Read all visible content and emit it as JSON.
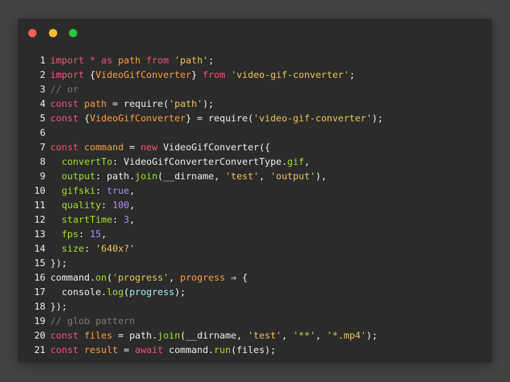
{
  "window": {
    "controls": [
      {
        "name": "close",
        "color": "#ff5f56"
      },
      {
        "name": "minimize",
        "color": "#ffbd2e"
      },
      {
        "name": "maximize",
        "color": "#27c93f"
      }
    ]
  },
  "colors": {
    "background": "#434343",
    "editor": "#2a2b2a",
    "keyword": "#f5547c",
    "variable": "#ff9f43",
    "string": "#f1c45d",
    "function": "#a6e22e",
    "number": "#b18cff",
    "comment": "#7d7d74"
  },
  "code": {
    "lines": [
      {
        "n": "1",
        "tokens": [
          [
            "import",
            "kw"
          ],
          [
            " ",
            "pl"
          ],
          [
            "*",
            "kw"
          ],
          [
            " ",
            "pl"
          ],
          [
            "as",
            "kw"
          ],
          [
            " ",
            "pl"
          ],
          [
            "path",
            "var"
          ],
          [
            " ",
            "pl"
          ],
          [
            "from",
            "kw"
          ],
          [
            " ",
            "pl"
          ],
          [
            "'path'",
            "str"
          ],
          [
            ";",
            "pl"
          ]
        ]
      },
      {
        "n": "2",
        "tokens": [
          [
            "import",
            "kw"
          ],
          [
            " {",
            "pl"
          ],
          [
            "VideoGifConverter",
            "var"
          ],
          [
            "} ",
            "pl"
          ],
          [
            "from",
            "kw"
          ],
          [
            " ",
            "pl"
          ],
          [
            "'video-gif-converter'",
            "str"
          ],
          [
            ";",
            "pl"
          ]
        ]
      },
      {
        "n": "3",
        "tokens": [
          [
            "// or",
            "cm"
          ]
        ]
      },
      {
        "n": "4",
        "tokens": [
          [
            "const",
            "kw"
          ],
          [
            " ",
            "pl"
          ],
          [
            "path",
            "var"
          ],
          [
            " = require(",
            "pl"
          ],
          [
            "'path'",
            "str"
          ],
          [
            ");",
            "pl"
          ]
        ]
      },
      {
        "n": "5",
        "tokens": [
          [
            "const",
            "kw"
          ],
          [
            " {",
            "pl"
          ],
          [
            "VideoGifConverter",
            "var"
          ],
          [
            "} = require(",
            "pl"
          ],
          [
            "'video-gif-converter'",
            "str"
          ],
          [
            ");",
            "pl"
          ]
        ]
      },
      {
        "n": "6",
        "tokens": []
      },
      {
        "n": "7",
        "tokens": [
          [
            "const",
            "kw"
          ],
          [
            " ",
            "pl"
          ],
          [
            "command",
            "var"
          ],
          [
            " = ",
            "pl"
          ],
          [
            "new",
            "kw"
          ],
          [
            " VideoGifConverter({",
            "pl"
          ]
        ]
      },
      {
        "n": "8",
        "tokens": [
          [
            "  ",
            "pl"
          ],
          [
            "convertTo",
            "prop"
          ],
          [
            ": VideoGifConverterConvertType.",
            "pl"
          ],
          [
            "gif",
            "fn"
          ],
          [
            ",",
            "pl"
          ]
        ]
      },
      {
        "n": "9",
        "tokens": [
          [
            "  ",
            "pl"
          ],
          [
            "output",
            "prop"
          ],
          [
            ": path.",
            "pl"
          ],
          [
            "join",
            "fn"
          ],
          [
            "(__dirname, ",
            "pl"
          ],
          [
            "'test'",
            "str"
          ],
          [
            ", ",
            "pl"
          ],
          [
            "'output'",
            "str"
          ],
          [
            "),",
            "pl"
          ]
        ]
      },
      {
        "n": "10",
        "tokens": [
          [
            "  ",
            "pl"
          ],
          [
            "gifski",
            "prop"
          ],
          [
            ": ",
            "pl"
          ],
          [
            "true",
            "bool"
          ],
          [
            ",",
            "pl"
          ]
        ]
      },
      {
        "n": "11",
        "tokens": [
          [
            "  ",
            "pl"
          ],
          [
            "quality",
            "prop"
          ],
          [
            ": ",
            "pl"
          ],
          [
            "100",
            "num"
          ],
          [
            ",",
            "pl"
          ]
        ]
      },
      {
        "n": "12",
        "tokens": [
          [
            "  ",
            "pl"
          ],
          [
            "startTime",
            "prop"
          ],
          [
            ": ",
            "pl"
          ],
          [
            "3",
            "num"
          ],
          [
            ",",
            "pl"
          ]
        ]
      },
      {
        "n": "13",
        "tokens": [
          [
            "  ",
            "pl"
          ],
          [
            "fps",
            "prop"
          ],
          [
            ": ",
            "pl"
          ],
          [
            "15",
            "num"
          ],
          [
            ",",
            "pl"
          ]
        ]
      },
      {
        "n": "14",
        "tokens": [
          [
            "  ",
            "pl"
          ],
          [
            "size",
            "prop"
          ],
          [
            ": ",
            "pl"
          ],
          [
            "'640x?'",
            "str"
          ]
        ]
      },
      {
        "n": "15",
        "tokens": [
          [
            "});",
            "pl"
          ]
        ]
      },
      {
        "n": "16",
        "tokens": [
          [
            "command.",
            "pl"
          ],
          [
            "on",
            "fn"
          ],
          [
            "(",
            "pl"
          ],
          [
            "'progress'",
            "str"
          ],
          [
            ", ",
            "pl"
          ],
          [
            "progress",
            "var"
          ],
          [
            " ⇒ {",
            "pl"
          ]
        ]
      },
      {
        "n": "17",
        "tokens": [
          [
            "  console.",
            "pl"
          ],
          [
            "log",
            "fn"
          ],
          [
            "(",
            "pl"
          ],
          [
            "progress",
            "arg"
          ],
          [
            ");",
            "pl"
          ]
        ]
      },
      {
        "n": "18",
        "tokens": [
          [
            "});",
            "pl"
          ]
        ]
      },
      {
        "n": "19",
        "tokens": [
          [
            "// glob pattern",
            "cm"
          ]
        ]
      },
      {
        "n": "20",
        "tokens": [
          [
            "const",
            "kw"
          ],
          [
            " ",
            "pl"
          ],
          [
            "files",
            "var"
          ],
          [
            " = path.",
            "pl"
          ],
          [
            "join",
            "fn"
          ],
          [
            "(__dirname, ",
            "pl"
          ],
          [
            "'test'",
            "str"
          ],
          [
            ", ",
            "pl"
          ],
          [
            "'**'",
            "str"
          ],
          [
            ", ",
            "pl"
          ],
          [
            "'*.mp4'",
            "str"
          ],
          [
            ");",
            "pl"
          ]
        ]
      },
      {
        "n": "21",
        "tokens": [
          [
            "const",
            "kw"
          ],
          [
            " ",
            "pl"
          ],
          [
            "result",
            "var"
          ],
          [
            " = ",
            "pl"
          ],
          [
            "await",
            "kw"
          ],
          [
            " command.",
            "pl"
          ],
          [
            "run",
            "fn"
          ],
          [
            "(files);",
            "pl"
          ]
        ]
      }
    ]
  }
}
